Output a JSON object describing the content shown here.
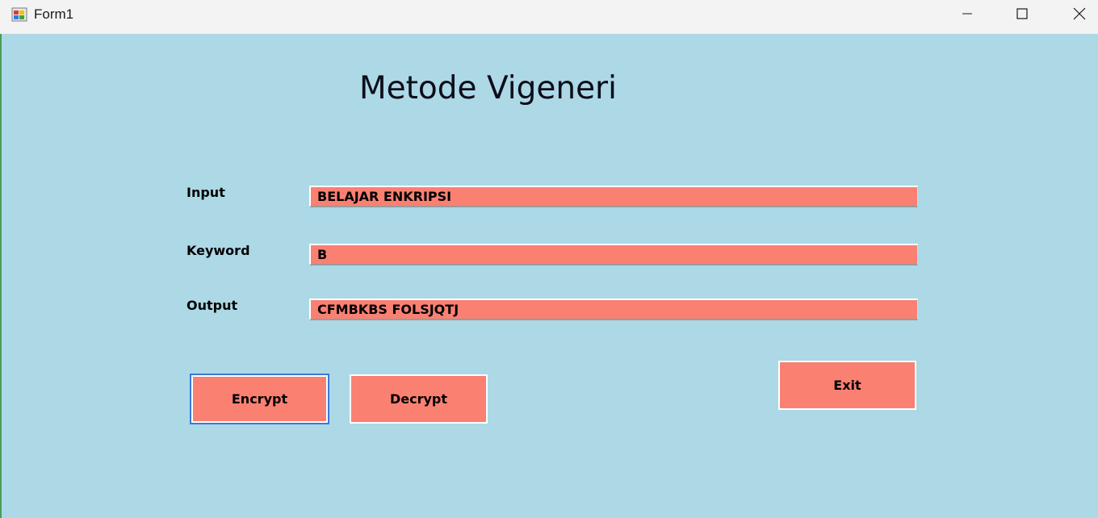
{
  "window": {
    "title": "Form1",
    "background": "#add8e6"
  },
  "form": {
    "heading": "Metode Vigeneri",
    "fields": [
      {
        "label": "Input",
        "value": "BELAJAR ENKRIPSI"
      },
      {
        "label": "Keyword",
        "value": "B"
      },
      {
        "label": "Output",
        "value": "CFMBKBS FOLSJQTJ"
      }
    ],
    "buttons": {
      "encrypt": "Encrypt",
      "decrypt": "Decrypt",
      "exit": "Exit"
    },
    "accent_color": "#fa8072"
  }
}
